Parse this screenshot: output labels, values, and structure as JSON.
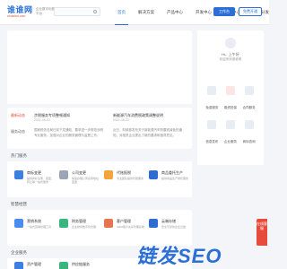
{
  "header": {
    "logo_text": "谁谁网",
    "logo_sub": "shuishui.com",
    "slogan": "企业数字化服务平台",
    "search_placeholder": "",
    "nav": [
      "首页",
      "解决方案",
      "产品中心",
      "开发中心",
      "万能中心",
      "软件分发"
    ],
    "btn_primary": "工作台",
    "btn_outline": "免费开通"
  },
  "sidebar": {
    "greeting": "Hi，上午好",
    "sub": "欢迎来到谁谁网",
    "items": [
      {
        "label": "免费服务",
        "icon": "document-icon",
        "color": "#e8edf4"
      },
      {
        "label": "融资担保",
        "icon": "fund-icon",
        "color": "#fbe6e3"
      },
      {
        "label": "合同服务",
        "icon": "contract-icon",
        "color": "#e8edf4"
      },
      {
        "label": "信息发布",
        "icon": "info-icon",
        "color": "#e8edf4"
      },
      {
        "label": "企业服务",
        "icon": "company-icon",
        "color": "#e8edf4"
      },
      {
        "label": "商标查询",
        "icon": "trademark-icon",
        "color": "#e8edf4"
      }
    ]
  },
  "news": {
    "tabs": [
      "最新动态",
      "服务动态"
    ],
    "items": [
      {
        "title": "涉税服务专项整顿通知",
        "date": "2021-06-22",
        "body": "国家税务总局日前下发通知，要求进一步规范涉税专业服务，加强对企业的服务管理与监督工作。"
      },
      {
        "title": "新能源汽车消费税政策调整说明",
        "date": "2021-06-22",
        "body": "近日，财政部发布关于新能源汽车购置税减免的通知，对相关企业提出了新的要求和指导意见。"
      }
    ]
  },
  "sections": [
    {
      "label": "热门服务",
      "cards": [
        {
          "title": "商标变更",
          "desc": "提供商标注册、变更、转让等一站式服务",
          "icon": "trademark-icon",
          "color": "#3d7fe0"
        },
        {
          "title": "公司变更",
          "desc": "快速办理公司名称地址变更",
          "icon": "company-icon",
          "color": "#9aa6b8"
        },
        {
          "title": "代账报税",
          "desc": "专业团队提供代账服务",
          "icon": "tax-icon",
          "color": "#f3a43b"
        },
        {
          "title": "商品委托生产",
          "desc": "提供商品生产委托服务",
          "icon": "shield-icon",
          "color": "#2f6bd1"
        }
      ]
    },
    {
      "label": "智慧经营",
      "cards": [
        {
          "title": "营销系统",
          "desc": "一站式营销管理工具",
          "icon": "marketing-icon",
          "color": "#4a8cf0"
        },
        {
          "title": "财务管理",
          "desc": "企业财务数字化管理",
          "icon": "finance-icon",
          "color": "#3ab57e"
        },
        {
          "title": "客户管理",
          "desc": "CRM客户关系管理系统",
          "icon": "crm-icon",
          "color": "#e6744c"
        },
        {
          "title": "云端存储",
          "desc": "安全可靠的企业云盘",
          "icon": "cloud-icon",
          "color": "#2f6bd1"
        }
      ]
    },
    {
      "label": "企业服务",
      "cards": [
        {
          "title": "资产管理",
          "desc": "",
          "icon": "asset-icon",
          "color": "#3d7fe0"
        },
        {
          "title": "供应链服务",
          "desc": "",
          "icon": "supply-icon",
          "color": "#3ab57e"
        }
      ]
    }
  ],
  "float": {
    "label": "在线客服"
  },
  "watermark": "链发SEO",
  "colors": {
    "brand": "#2b6fd6",
    "accent": "#e64b3c"
  }
}
